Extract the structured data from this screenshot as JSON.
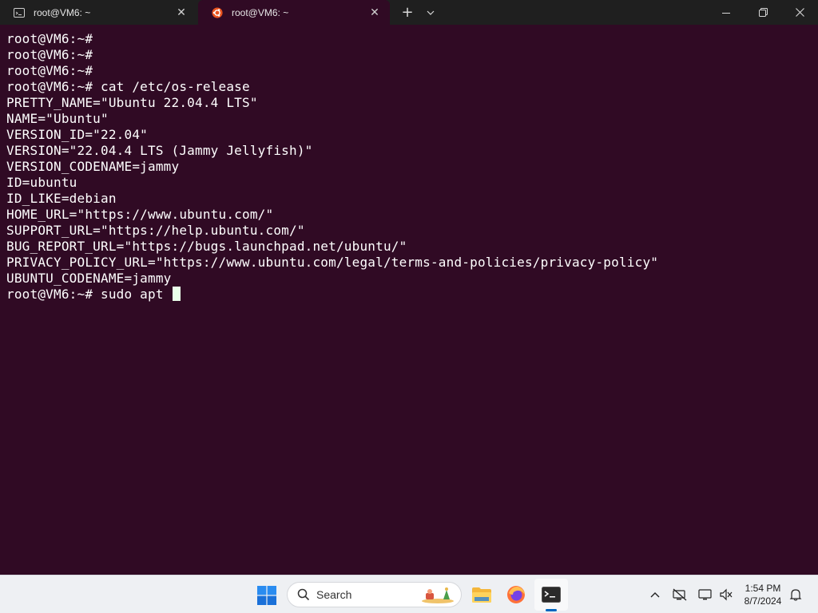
{
  "titlebar": {
    "tabs": [
      {
        "title": "root@VM6: ~",
        "icon": "cmd-icon",
        "active": false
      },
      {
        "title": "root@VM6: ~",
        "icon": "ubuntu-icon",
        "active": true
      }
    ],
    "new_tab_symbol": "+",
    "close_symbol": "✕"
  },
  "terminal": {
    "background": "#300a24",
    "lines": [
      "root@VM6:~#",
      "root@VM6:~#",
      "root@VM6:~#",
      "root@VM6:~# cat /etc/os-release",
      "PRETTY_NAME=\"Ubuntu 22.04.4 LTS\"",
      "NAME=\"Ubuntu\"",
      "VERSION_ID=\"22.04\"",
      "VERSION=\"22.04.4 LTS (Jammy Jellyfish)\"",
      "VERSION_CODENAME=jammy",
      "ID=ubuntu",
      "ID_LIKE=debian",
      "HOME_URL=\"https://www.ubuntu.com/\"",
      "SUPPORT_URL=\"https://help.ubuntu.com/\"",
      "BUG_REPORT_URL=\"https://bugs.launchpad.net/ubuntu/\"",
      "PRIVACY_POLICY_URL=\"https://www.ubuntu.com/legal/terms-and-policies/privacy-policy\"",
      "UBUNTU_CODENAME=jammy"
    ],
    "prompt_line": "root@VM6:~# sudo apt "
  },
  "taskbar": {
    "search_label": "Search",
    "apps": [
      "start-icon",
      "file-explorer-icon",
      "firefox-icon",
      "terminal-icon"
    ],
    "tray": [
      "chevron-up-icon",
      "network-off-icon",
      "display-icon",
      "volume-muted-icon",
      "notification-bell-icon"
    ],
    "time": "1:54 PM",
    "date": "8/7/2024",
    "accent": "#0067c0"
  }
}
